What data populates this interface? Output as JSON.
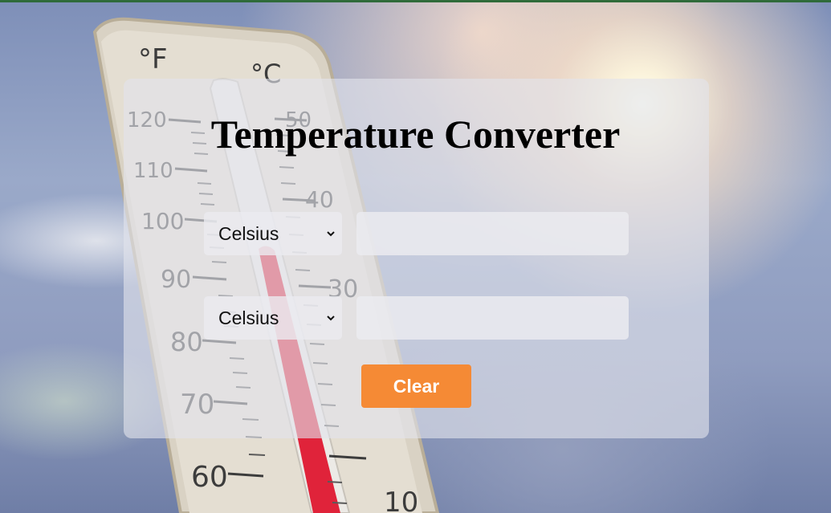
{
  "page": {
    "title": "Temperature Converter"
  },
  "background": {
    "fahrenheit_symbol": "°F",
    "celsius_symbol": "°C",
    "fahrenheit_marks": [
      "120",
      "110",
      "100",
      "90",
      "80",
      "70",
      "60"
    ],
    "celsius_marks": [
      "50",
      "40",
      "30",
      "10"
    ],
    "icon": "thermometer-image"
  },
  "converter": {
    "from": {
      "unit": "Celsius",
      "options": [
        "Celsius"
      ],
      "value": ""
    },
    "to": {
      "unit": "Celsius",
      "options": [
        "Celsius"
      ],
      "value": ""
    },
    "clear_label": "Clear"
  },
  "colors": {
    "accent": "#f58a35",
    "top_bar": "#2f6b3a",
    "mercury": "#e0233a"
  }
}
